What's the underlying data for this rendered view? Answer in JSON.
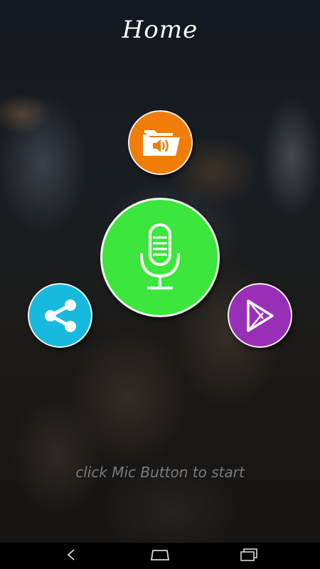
{
  "header": {
    "title": "Home"
  },
  "buttons": {
    "folder": {
      "icon": "folder-audio-icon",
      "color": "#f07c09"
    },
    "mic": {
      "icon": "microphone-icon",
      "color": "#3ce63c"
    },
    "share": {
      "icon": "share-icon",
      "color": "#17b9de"
    },
    "play": {
      "icon": "play-store-icon",
      "color": "#9a2fb7"
    }
  },
  "hint": {
    "text": "click Mic Button to start"
  },
  "navbar": {
    "back": {
      "icon": "back-icon"
    },
    "home": {
      "icon": "home-icon"
    },
    "recent": {
      "icon": "recent-apps-icon"
    }
  }
}
